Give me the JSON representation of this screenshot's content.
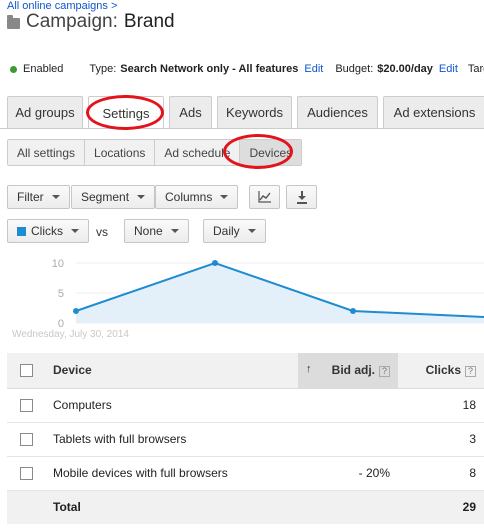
{
  "breadcrumb": "All online campaigns >",
  "campaign": {
    "prefix": "Campaign:",
    "name": "Brand"
  },
  "status": {
    "enabled": "Enabled",
    "type_label": "Type:",
    "type_value": "Search Network only - All features",
    "edit1": "Edit",
    "budget_label": "Budget:",
    "budget_value": "$20.00/day",
    "edit2": "Edit",
    "targ": "Targ"
  },
  "tabs": [
    "Ad groups",
    "Settings",
    "Ads",
    "Keywords",
    "Audiences",
    "Ad extensions"
  ],
  "active_tab": "Settings",
  "subtabs": [
    "All settings",
    "Locations",
    "Ad schedule",
    "Devices"
  ],
  "active_subtab": "Devices",
  "toolbar": {
    "filter": "Filter",
    "segment": "Segment",
    "columns": "Columns",
    "graph_icon": "line-chart-icon",
    "download_icon": "download-icon"
  },
  "chart_controls": {
    "metric1": "Clicks",
    "metric1_color": "#1f8bd1",
    "vs": "vs",
    "metric2": "None",
    "period": "Daily"
  },
  "chart_data": {
    "type": "area",
    "y_ticks": [
      "10",
      "5",
      "0"
    ],
    "ylim": [
      0,
      10
    ],
    "x_label_first": "Wednesday, July 30, 2014",
    "values": [
      2,
      10,
      2,
      1
    ],
    "color": "#1f8bd1",
    "fill": "#e3f0f9"
  },
  "table": {
    "headers": {
      "device": "Device",
      "bid_adj": "Bid adj.",
      "clicks": "Clicks",
      "help": "?",
      "sort_arrow": "↑"
    },
    "rows": [
      {
        "device": "Computers",
        "bid_adj": "",
        "clicks": "18"
      },
      {
        "device": "Tablets with full browsers",
        "bid_adj": "",
        "clicks": "3"
      },
      {
        "device": "Mobile devices with full browsers",
        "bid_adj": "- 20%",
        "clicks": "8"
      }
    ],
    "total": {
      "label": "Total",
      "clicks": "29"
    }
  },
  "annotation_color": "#e3121b"
}
